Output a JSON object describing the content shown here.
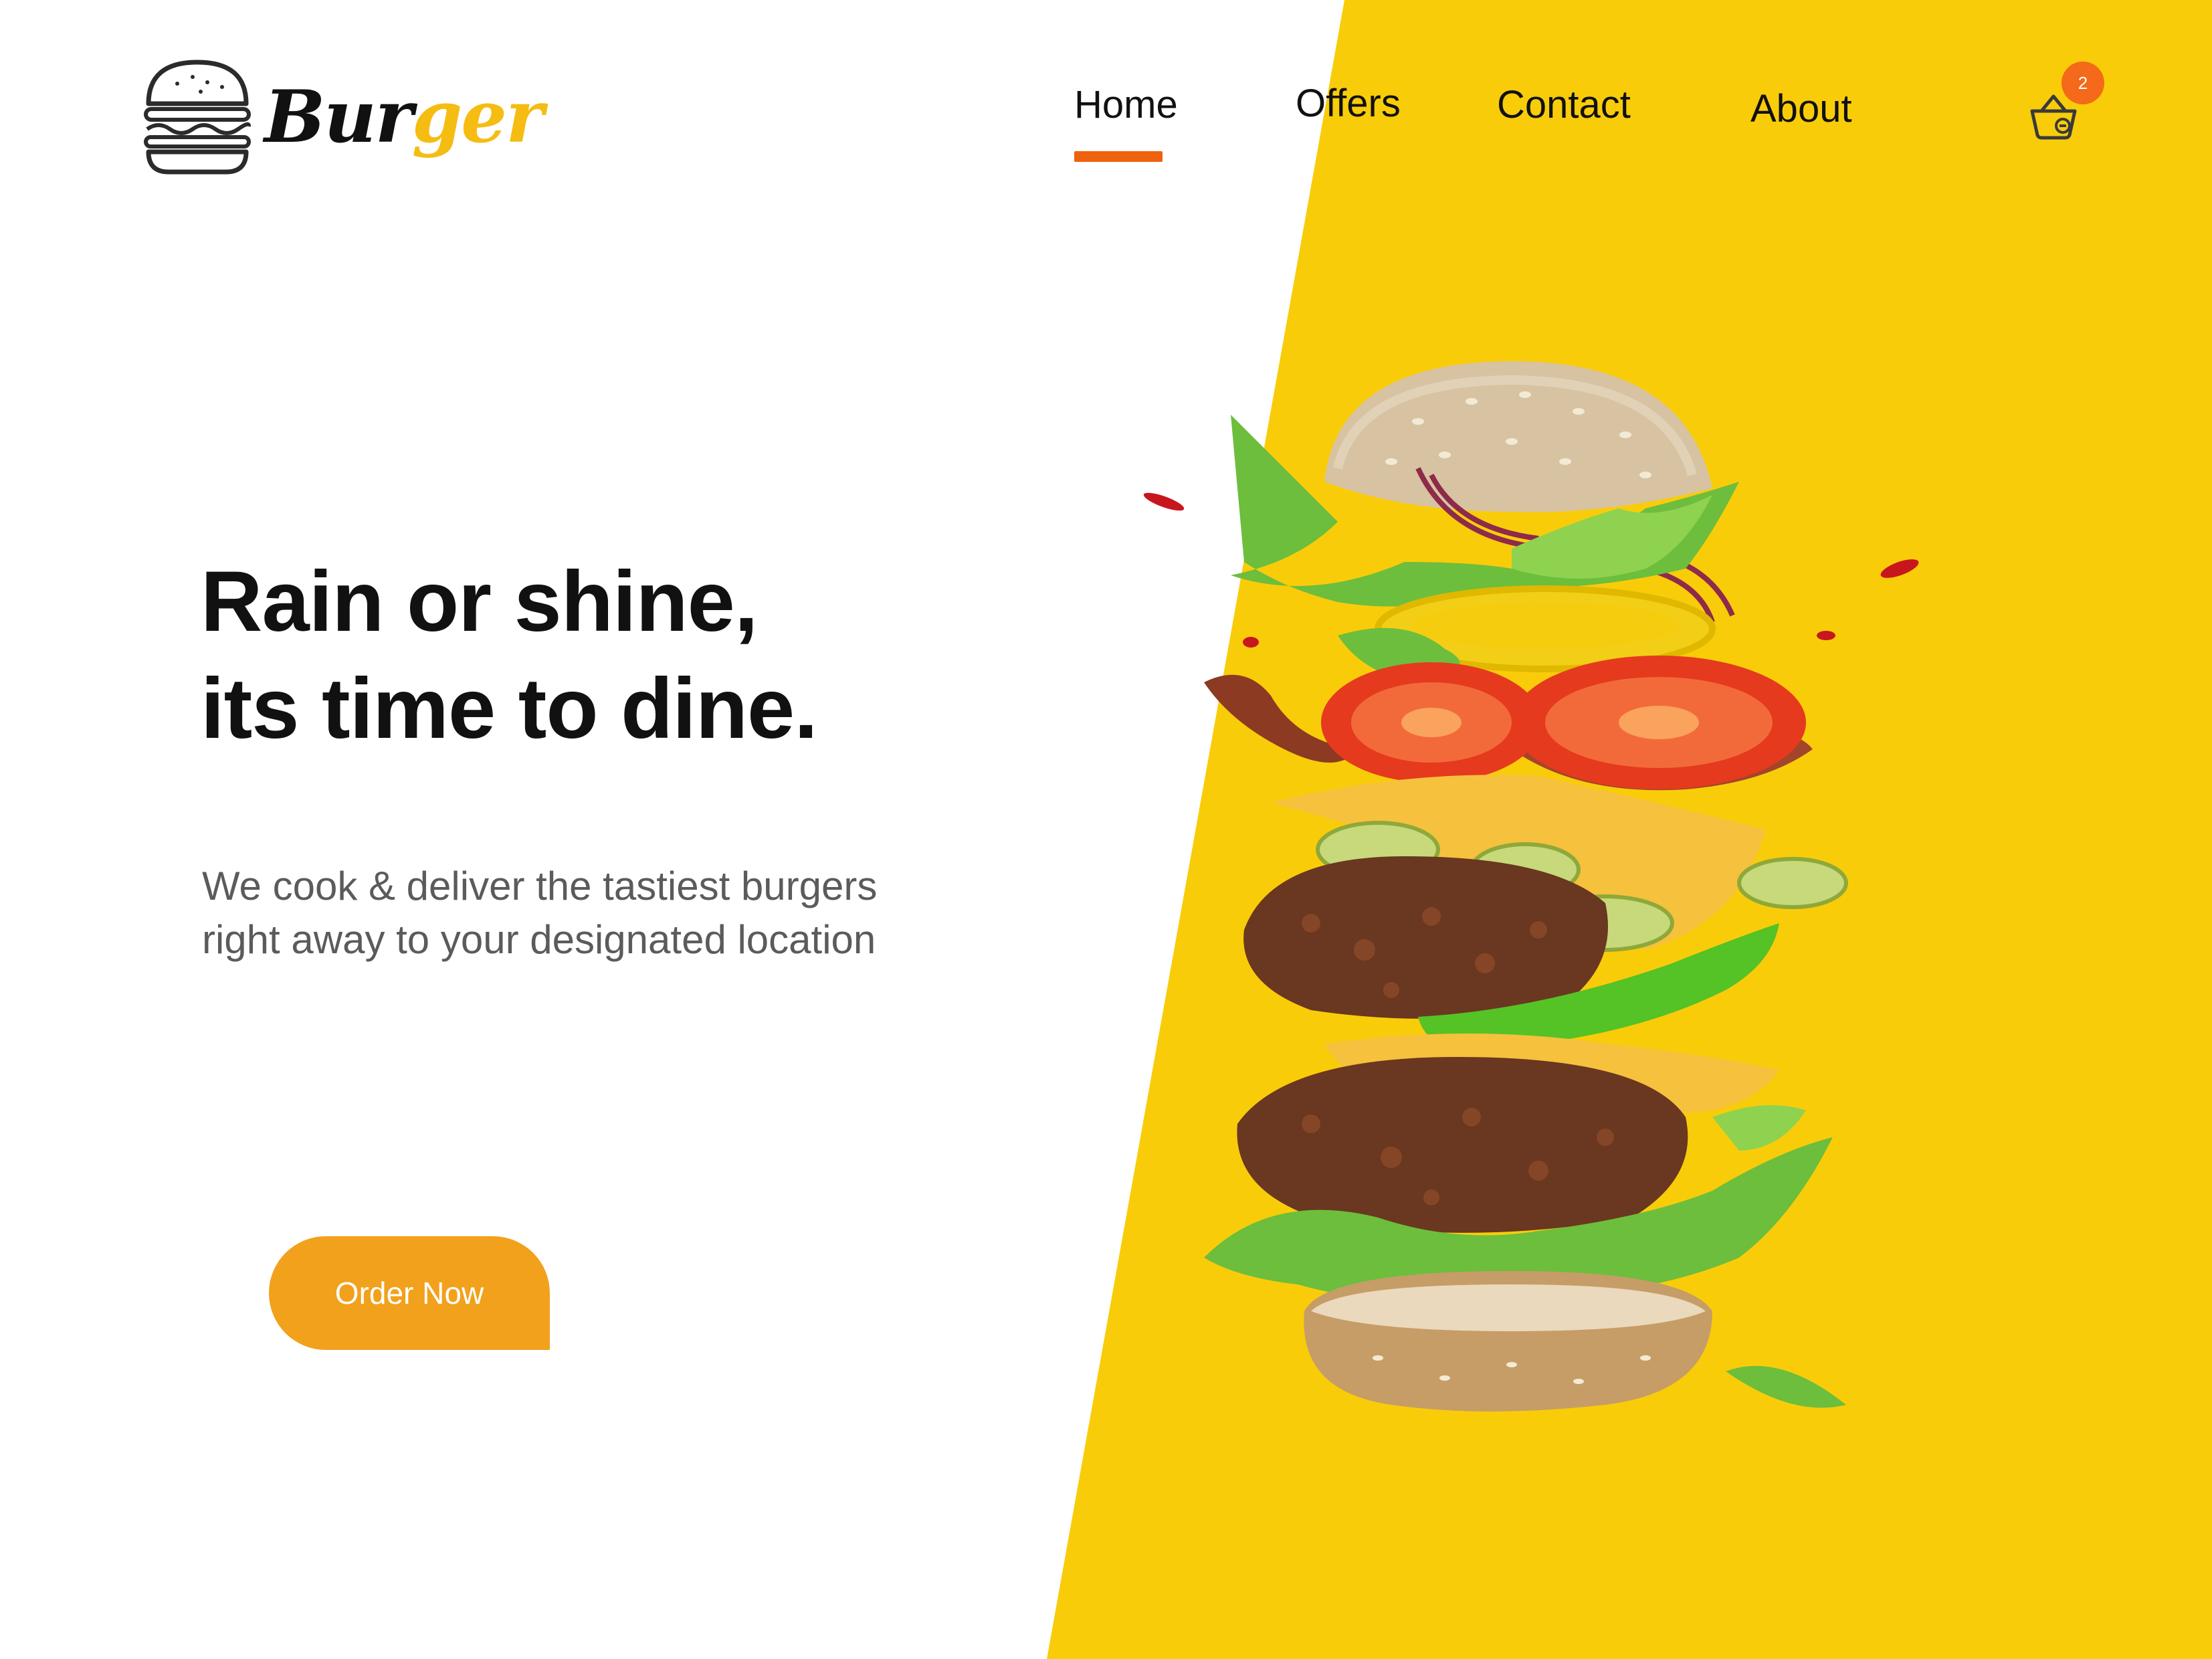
{
  "colors": {
    "brand_yellow": "#f9cc0a",
    "accent_orange": "#f0610d",
    "button_orange": "#f2a11c",
    "badge_orange": "#f5691a",
    "text_dark": "#111111",
    "text_muted": "#5b5b5b"
  },
  "brand": {
    "logo_icon": "burger-icon",
    "name_part1": "Bur",
    "name_part2": "ger"
  },
  "nav": {
    "items": [
      {
        "label": "Home",
        "active": true
      },
      {
        "label": "Offers",
        "active": false
      },
      {
        "label": "Contact",
        "active": false
      },
      {
        "label": "About",
        "active": false
      }
    ]
  },
  "cart": {
    "icon": "shopping-basket-icon",
    "count": "2"
  },
  "hero": {
    "title_line1": "Rain or shine,",
    "title_line2": "its time to dine.",
    "subtitle_line1": "We cook & deliver the tastiest burgers",
    "subtitle_line2": "right away to your designated location",
    "cta_label": "Order Now",
    "image": "flying-burger-ingredients"
  }
}
